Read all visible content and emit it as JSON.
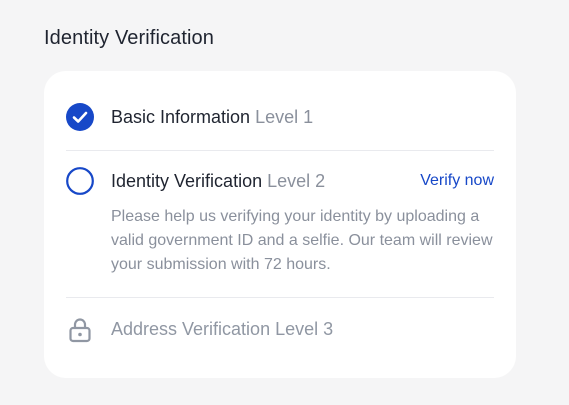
{
  "section": {
    "title": "Identity Verification"
  },
  "steps": [
    {
      "title": "Basic Information",
      "level": "Level 1",
      "status": "completed",
      "icon": "check-circle-icon"
    },
    {
      "title": "Identity Verification",
      "level": "Level 2",
      "status": "pending",
      "icon": "empty-circle-icon",
      "action_label": "Verify now",
      "description": "Please help us verifying your identity by uploading a valid government ID and a selfie. Our team will review your submission with 72 hours."
    },
    {
      "title": "Address Verification",
      "level": "Level 3",
      "status": "locked",
      "icon": "lock-icon"
    }
  ],
  "colors": {
    "accent": "#1748c8",
    "background": "#f5f5f6",
    "card": "#ffffff",
    "text_primary": "#1f2430",
    "text_muted": "#8a909c"
  }
}
